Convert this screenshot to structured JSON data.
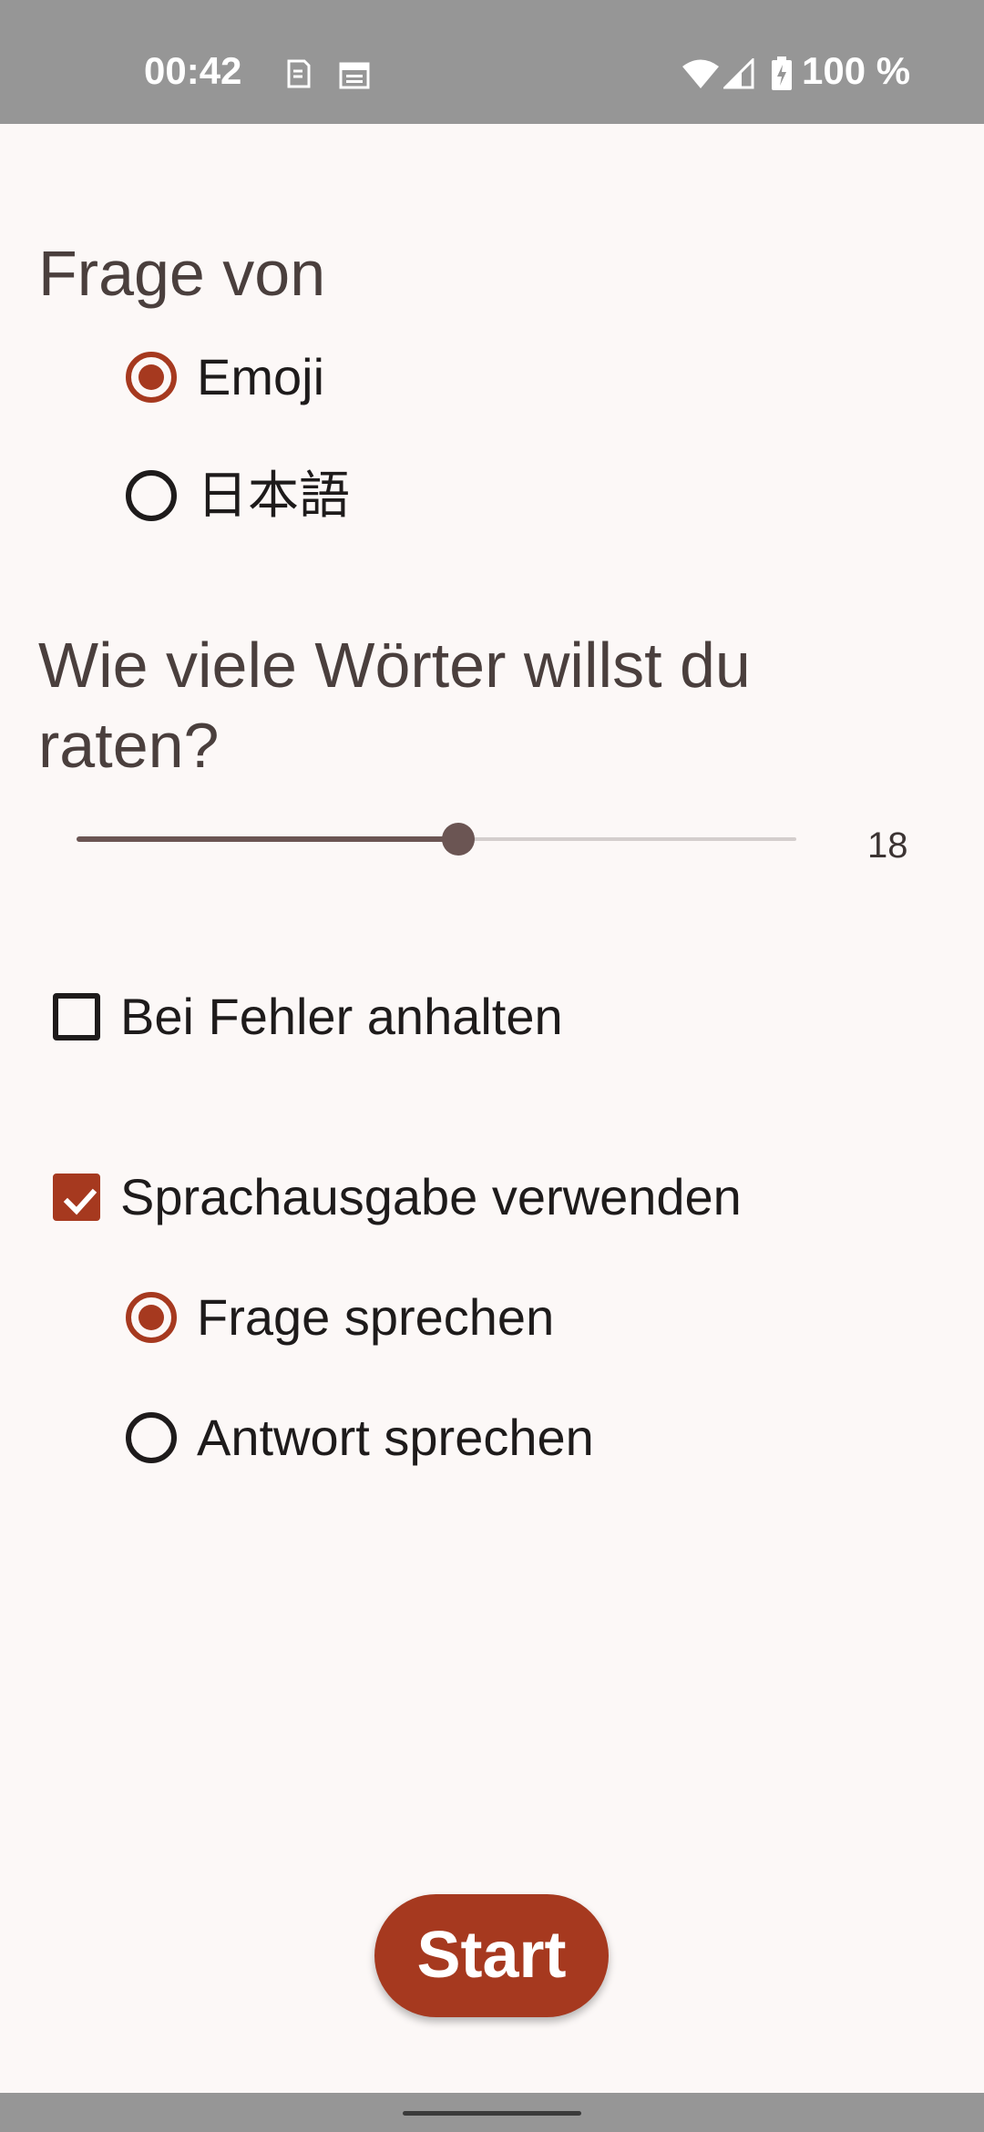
{
  "status_bar": {
    "time": "00:42",
    "icons": [
      "sim-icon",
      "calendar-icon",
      "wifi-icon",
      "signal-icon",
      "battery-charging-icon"
    ],
    "battery_text": "100 %"
  },
  "question_source": {
    "heading": "Frage von",
    "options": [
      {
        "label": "Emoji",
        "selected": true
      },
      {
        "label": "日本語",
        "selected": false
      }
    ]
  },
  "word_count": {
    "heading_line1": "Wie viele Wörter willst du",
    "heading_line2": "raten?",
    "value": "18",
    "slider_fraction": 0.53
  },
  "stop_on_error": {
    "label": "Bei Fehler anhalten",
    "checked": false
  },
  "speech": {
    "label": "Sprachausgabe verwenden",
    "checked": true,
    "options": [
      {
        "label": "Frage sprechen",
        "selected": true
      },
      {
        "label": "Antwort sprechen",
        "selected": false
      }
    ]
  },
  "start_button": {
    "label": "Start"
  },
  "colors": {
    "accent": "#a6391f",
    "background": "#fcf8f7",
    "status_bar": "#969696",
    "slider_active": "#6b5553",
    "slider_inactive": "#d4cecd"
  }
}
